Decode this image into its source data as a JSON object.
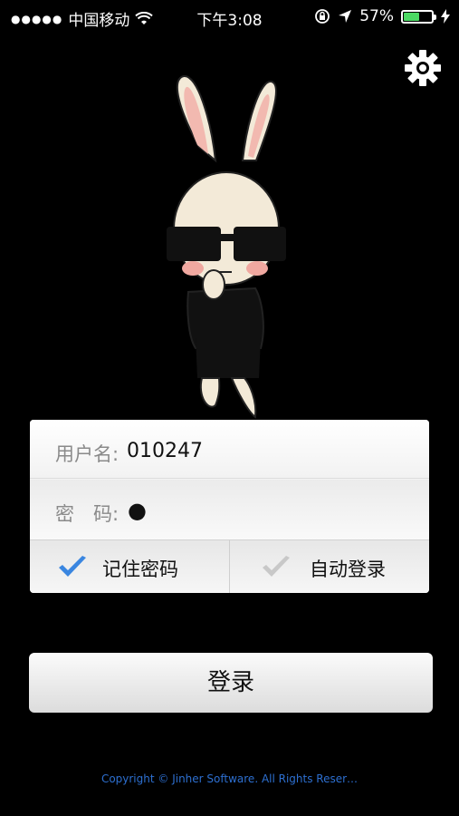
{
  "status_bar": {
    "carrier": "中国移动",
    "time": "下午3:08",
    "battery_percent": "57%",
    "battery_level": 0.57,
    "battery_color": "#4cd964"
  },
  "settings": {
    "icon": "gear-icon"
  },
  "login": {
    "username_label": "用户名:",
    "username_value": "010247",
    "password_label": "密　码:",
    "password_value": "●",
    "remember_label": "记住密码",
    "remember_checked": true,
    "auto_label": "自动登录",
    "auto_checked": false,
    "check_on_color": "#3a86e0",
    "check_off_color": "#c8c8c8"
  },
  "login_button": {
    "label": "登录"
  },
  "footer": {
    "copyright": "Copyright © Jinher Software. All Rights Reser…"
  }
}
